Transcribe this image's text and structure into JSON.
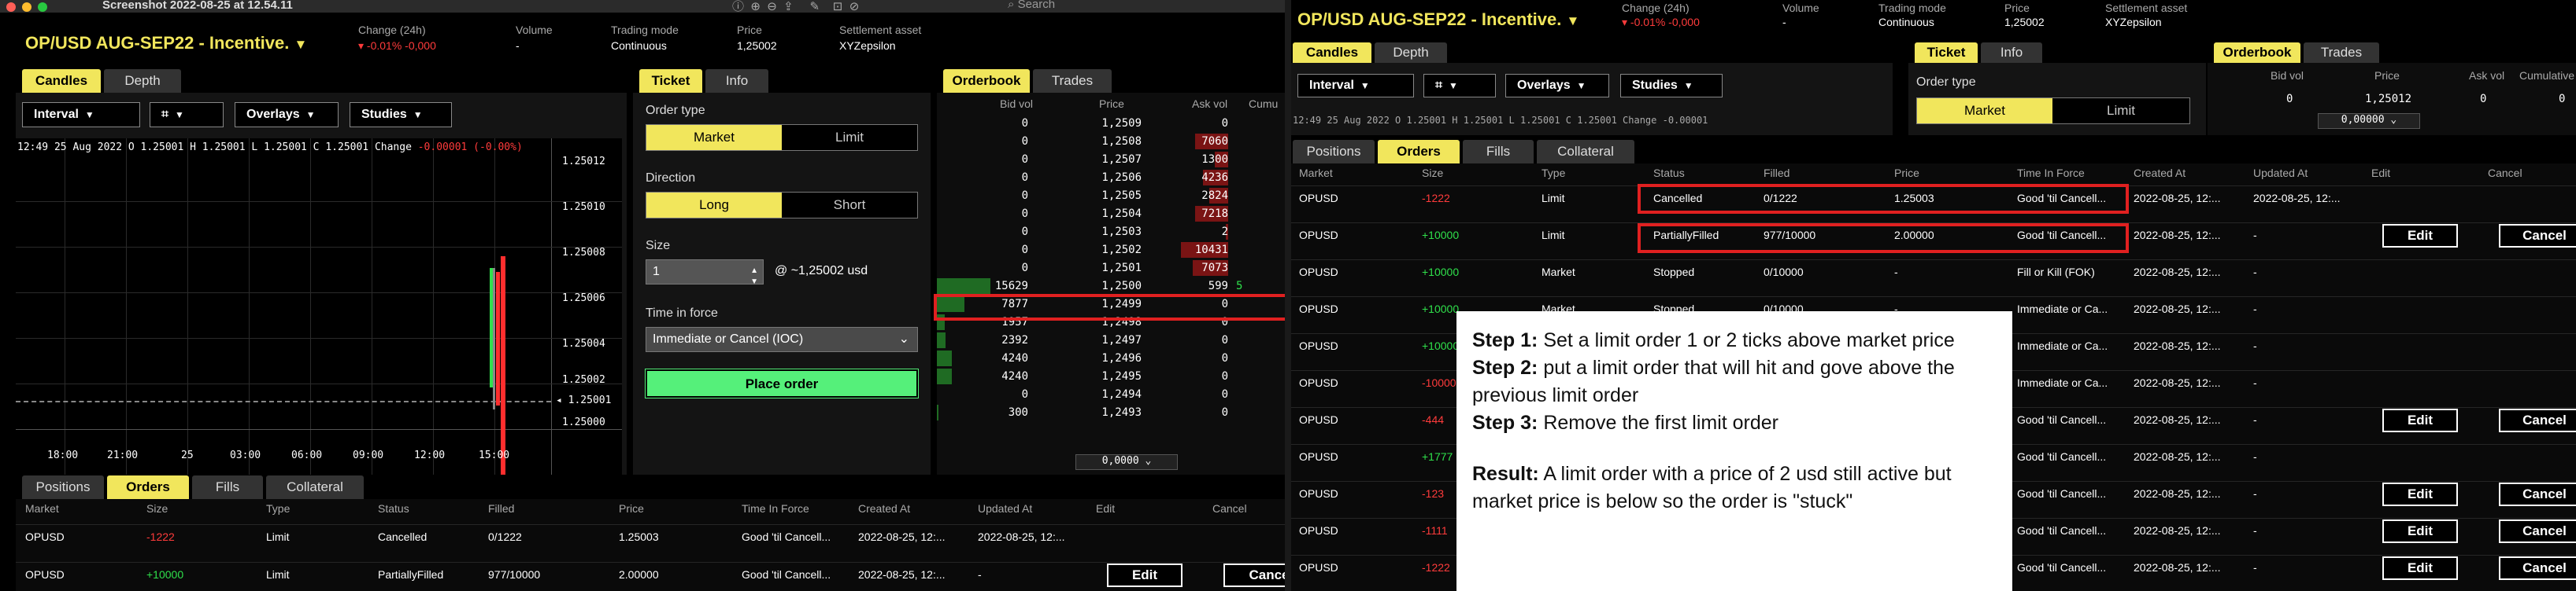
{
  "left": {
    "mac_title": "Screenshot 2022-08-25 at 12.54.11",
    "search_placeholder": "Search",
    "market": {
      "name": "OP/USD AUG-SEP22 - Incentive.",
      "change_label": "Change (24h)",
      "change_value": "▾ -0.01% -0,000",
      "volume_label": "Volume",
      "volume_value": "-",
      "trading_mode_label": "Trading mode",
      "trading_mode_value": "Continuous",
      "price_label": "Price",
      "price_value": "1,25002",
      "settlement_label": "Settlement asset",
      "settlement_value": "XYZepsilon"
    },
    "chart_tabs": [
      "Candles",
      "Depth"
    ],
    "chart_toolbar": {
      "interval": "Interval",
      "overlays": "Overlays",
      "studies": "Studies"
    },
    "ohlc": "12:49 25 Aug 2022 O 1.25001 H 1.25001 L 1.25001 C 1.25001 Change",
    "ohlc_change": "-0.00001 (-0.00%)",
    "y_ticks": [
      "1.25012",
      "1.25010",
      "1.25008",
      "1.25006",
      "1.25004",
      "1.25002",
      "1.25001",
      "1.25000"
    ],
    "x_ticks": [
      "18:00",
      "21:00",
      "25",
      "03:00",
      "06:00",
      "09:00",
      "12:00",
      "15:00"
    ],
    "ticket_tabs": [
      "Ticket",
      "Info"
    ],
    "ticket": {
      "order_type_label": "Order type",
      "order_type_options": [
        "Market",
        "Limit"
      ],
      "direction_label": "Direction",
      "direction_options": [
        "Long",
        "Short"
      ],
      "size_label": "Size",
      "size_value": "1",
      "size_estimate": "@ ~1,25002 usd",
      "tif_label": "Time in force",
      "tif_value": "Immediate or Cancel (IOC)",
      "place_order": "Place order"
    },
    "orderbook_tabs": [
      "Orderbook",
      "Trades"
    ],
    "orderbook": {
      "headers": [
        "Bid vol",
        "Price",
        "Ask vol",
        "Cumu"
      ],
      "rows": [
        {
          "bid": "0",
          "price": "1,2509",
          "ask": "0",
          "askbar": 0
        },
        {
          "bid": "0",
          "price": "1,2508",
          "ask": "7060",
          "askbar": 0.28
        },
        {
          "bid": "0",
          "price": "1,2507",
          "ask": "1300",
          "askbar": 0.11
        },
        {
          "bid": "0",
          "price": "1,2506",
          "ask": "4236",
          "askbar": 0.21
        },
        {
          "bid": "0",
          "price": "1,2505",
          "ask": "2824",
          "askbar": 0.16
        },
        {
          "bid": "0",
          "price": "1,2504",
          "ask": "7218",
          "askbar": 0.28
        },
        {
          "bid": "0",
          "price": "1,2503",
          "ask": "2",
          "askbar": 0.02
        },
        {
          "bid": "0",
          "price": "1,2502",
          "ask": "10431",
          "askbar": 0.4
        },
        {
          "bid": "0",
          "price": "1,2501",
          "ask": "7073",
          "askbar": 0.3
        },
        {
          "bid": "15629",
          "price": "1,2500",
          "ask": "599",
          "askbar": 0,
          "bidbar": 0.62
        },
        {
          "bid": "7877",
          "price": "1,2499",
          "ask": "0",
          "bidbar": 0.32
        },
        {
          "bid": "1957",
          "price": "1,2498",
          "ask": "0",
          "bidbar": 0.09
        },
        {
          "bid": "2392",
          "price": "1,2497",
          "ask": "0",
          "bidbar": 0.1
        },
        {
          "bid": "4240",
          "price": "1,2496",
          "ask": "0",
          "bidbar": 0.17
        },
        {
          "bid": "4240",
          "price": "1,2495",
          "ask": "0",
          "bidbar": 0.17
        },
        {
          "bid": "0",
          "price": "1,2494",
          "ask": "0",
          "bidbar": 0
        },
        {
          "bid": "300",
          "price": "1,2493",
          "ask": "0",
          "bidbar": 0.02
        }
      ],
      "highlight_cumu": "5",
      "footer_value": "0,0000"
    },
    "orders_tabs": [
      "Positions",
      "Orders",
      "Fills",
      "Collateral"
    ],
    "orders_headers": [
      "Market",
      "Size",
      "Type",
      "Status",
      "Filled",
      "Price",
      "Time In Force",
      "Created At",
      "Updated At",
      "Edit",
      "Cancel"
    ],
    "orders_rows": [
      {
        "market": "OPUSD",
        "size": "-1222",
        "type": "Limit",
        "status": "Cancelled",
        "filled": "0/1222",
        "price": "1.25003",
        "tif": "Good 'til Cancell...",
        "created": "2022-08-25, 12:...",
        "updated": "2022-08-25, 12:...",
        "edit": "",
        "cancel": ""
      },
      {
        "market": "OPUSD",
        "size": "+10000",
        "type": "Limit",
        "status": "PartiallyFilled",
        "filled": "977/10000",
        "price": "2.00000",
        "tif": "Good 'til Cancell...",
        "created": "2022-08-25, 12:...",
        "updated": "-",
        "edit": "Edit",
        "cancel": "Cance"
      }
    ]
  },
  "right": {
    "market": {
      "name": "OP/USD AUG-SEP22 - Incentive.",
      "change_label": "Change (24h)",
      "change_value": "▾ -0.01% -0,000",
      "volume_label": "Volume",
      "volume_value": "-",
      "trading_mode_label": "Trading mode",
      "trading_mode_value": "Continuous",
      "price_label": "Price",
      "price_value": "1,25002",
      "settlement_label": "Settlement asset",
      "settlement_value": "XYZepsilon"
    },
    "chart_tabs": [
      "Candles",
      "Depth"
    ],
    "chart_toolbar": {
      "interval": "Interval",
      "overlays": "Overlays",
      "studies": "Studies"
    },
    "ohlc_partial": "12:49 25 Aug 2022 O 1.25001 H 1.25001 L 1.25001 C 1.25001 Change -0.00001",
    "ticket_tabs": [
      "Ticket",
      "Info"
    ],
    "order_type_label": "Order type",
    "order_type_options": [
      "Market",
      "Limit"
    ],
    "orderbook_tabs": [
      "Orderbook",
      "Trades"
    ],
    "orderbook_headers": [
      "Bid vol",
      "Price",
      "Ask vol",
      "Cumulative"
    ],
    "orderbook_row": {
      "bid": "0",
      "price": "1,25012",
      "ask": "0",
      "cumu": "0"
    },
    "orderbook_footer": "0,00000",
    "orders_tabs": [
      "Positions",
      "Orders",
      "Fills",
      "Collateral"
    ],
    "orders_headers": [
      "Market",
      "Size",
      "Type",
      "Status",
      "Filled",
      "Price",
      "Time In Force",
      "Created At",
      "Updated At",
      "Edit",
      "Cancel"
    ],
    "orders_rows": [
      {
        "market": "OPUSD",
        "size": "-1222",
        "type": "Limit",
        "status": "Cancelled",
        "filled": "0/1222",
        "price": "1.25003",
        "tif": "Good 'til Cancell...",
        "created": "2022-08-25, 12:...",
        "updated": "2022-08-25, 12:...",
        "edit": "",
        "cancel": ""
      },
      {
        "market": "OPUSD",
        "size": "+10000",
        "type": "Limit",
        "status": "PartiallyFilled",
        "filled": "977/10000",
        "price": "2.00000",
        "tif": "Good 'til Cancell...",
        "created": "2022-08-25, 12:...",
        "updated": "-",
        "edit": "Edit",
        "cancel": "Cancel"
      },
      {
        "market": "OPUSD",
        "size": "+10000",
        "type": "Market",
        "status": "Stopped",
        "filled": "0/10000",
        "price": "-",
        "tif": "Fill or Kill (FOK)",
        "created": "2022-08-25, 12:...",
        "updated": "-",
        "edit": "",
        "cancel": ""
      },
      {
        "market": "OPUSD",
        "size": "+10000",
        "type": "Market",
        "status": "Stopped",
        "filled": "0/10000",
        "price": "-",
        "tif": "Immediate or Ca...",
        "created": "2022-08-25, 12:...",
        "updated": "-",
        "edit": "",
        "cancel": ""
      },
      {
        "market": "OPUSD",
        "size": "+10000",
        "type": "",
        "status": "",
        "filled": "",
        "price": "",
        "tif": "Immediate or Ca...",
        "created": "2022-08-25, 12:...",
        "updated": "-",
        "edit": "",
        "cancel": ""
      },
      {
        "market": "OPUSD",
        "size": "-10000",
        "type": "",
        "status": "",
        "filled": "",
        "price": "",
        "tif": "Immediate or Ca...",
        "created": "2022-08-25, 12:...",
        "updated": "-",
        "edit": "",
        "cancel": ""
      },
      {
        "market": "OPUSD",
        "size": "-444",
        "type": "",
        "status": "",
        "filled": "",
        "price": "",
        "tif": "Good 'til Cancell...",
        "created": "2022-08-25, 12:...",
        "updated": "-",
        "edit": "Edit",
        "cancel": "Cancel"
      },
      {
        "market": "OPUSD",
        "size": "+1777",
        "type": "",
        "status": "",
        "filled": "",
        "price": "",
        "tif": "Good 'til Cancell...",
        "created": "2022-08-25, 12:...",
        "updated": "-",
        "edit": "",
        "cancel": ""
      },
      {
        "market": "OPUSD",
        "size": "-123",
        "type": "",
        "status": "",
        "filled": "",
        "price": "",
        "tif": "Good 'til Cancell...",
        "created": "2022-08-25, 12:...",
        "updated": "-",
        "edit": "Edit",
        "cancel": "Cancel"
      },
      {
        "market": "OPUSD",
        "size": "-1111",
        "type": "",
        "status": "",
        "filled": "",
        "price": "",
        "tif": "Good 'til Cancell...",
        "created": "2022-08-25, 12:...",
        "updated": "-",
        "edit": "Edit",
        "cancel": "Cancel"
      },
      {
        "market": "OPUSD",
        "size": "-1222",
        "type": "",
        "status": "",
        "filled": "",
        "price": "",
        "tif": "Good 'til Cancell...",
        "created": "2022-08-25, 12:...",
        "updated": "-",
        "edit": "Edit",
        "cancel": "Cancel"
      }
    ],
    "note": {
      "step1_label": "Step 1:",
      "step1_text": "Set a limit order 1 or 2 ticks above market price",
      "step2_label": "Step 2:",
      "step2_text": "put a limit order that will hit and gove above the previous limit order",
      "step3_label": "Step 3:",
      "step3_text": "Remove the first limit order",
      "result_label": "Result:",
      "result_text": "A limit order with a price of 2 usd still active but market price is below so the order is \"stuck\""
    }
  },
  "colors": {
    "accent_yellow": "#f1e65c",
    "negative_red": "#ff3b3b",
    "positive_green": "#2fe04b",
    "place_order_green": "#55f07a",
    "highlight_box_red": "#e02020"
  }
}
